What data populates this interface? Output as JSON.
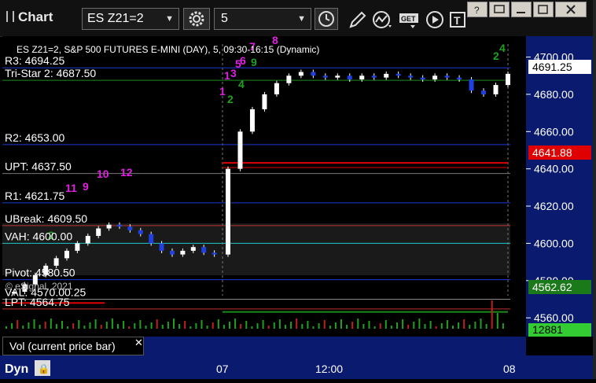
{
  "window": {
    "title": "Chart",
    "symbol": "ES Z21=2",
    "interval": "5",
    "dyn_label": "Dyn"
  },
  "chart": {
    "header_text": "ES Z21=2, S&P 500 FUTURES E-MINI (DAY), 5, 09:30-16:15 (Dynamic)",
    "copyright": "© eSignal, 2021",
    "volume_panel_label": "Vol (current price bar)",
    "levels": [
      {
        "label": "R3: 4694.25",
        "value": 4694.25,
        "color": "#1b3bd6"
      },
      {
        "label": "Tri-Star 2: 4687.50",
        "value": 4687.5,
        "color": "#1f8a1f"
      },
      {
        "label": "R2: 4653.00",
        "value": 4653.0,
        "color": "#1b3bd6"
      },
      {
        "label": "UPT: 4637.50",
        "value": 4637.5,
        "color": "#777777"
      },
      {
        "label": "R1: 4621.75",
        "value": 4621.75,
        "color": "#1b3bd6"
      },
      {
        "label": "UBreak: 4609.50",
        "value": 4609.5,
        "color": "#c23030"
      },
      {
        "label": "VAH: 4600.00",
        "value": 4600.0,
        "color": "#20c8c8"
      },
      {
        "label": "Pivot: 4580.50",
        "value": 4580.5,
        "color": "#1b3bd6"
      },
      {
        "label": "VAL: 4570.00.25",
        "value": 4570.0,
        "color": "#888888"
      },
      {
        "label": "LPT: 4564.75",
        "value": 4564.75,
        "color": "#c23030"
      }
    ],
    "price_ticks": [
      "4700.00",
      "4680.00",
      "4660.00",
      "4640.00",
      "4620.00",
      "4600.00",
      "4580.00",
      "4560.00"
    ],
    "price_range": [
      4555,
      4707
    ],
    "last_price": "4691.25",
    "red_marker_price": "4641.88",
    "green_marker_price": "4562.62",
    "volume_value": "12881",
    "time_labels": [
      "07",
      "12:00",
      "08"
    ]
  },
  "colors": {
    "axis_bg": "#0a1a6e",
    "last_price_bg": "#ffffff",
    "red_marker_bg": "#e00000",
    "green_marker_bg": "#1a7a1a",
    "volume_bg": "#33cc33",
    "magenta": "#e020e0",
    "seq_green": "#20a020"
  },
  "chart_data": {
    "type": "candlestick",
    "title": "ES Z21=2, S&P 500 FUTURES E-MINI (DAY), 5, 09:30-16:15 (Dynamic)",
    "ylim": [
      4555,
      4707
    ],
    "x_labels": [
      "07",
      "12:00",
      "08"
    ],
    "series": [
      {
        "name": "price",
        "values": [
          4574,
          4578,
          4583,
          4588,
          4592,
          4596,
          4600,
          4604,
          4608,
          4610,
          4609,
          4607,
          4605,
          4600,
          4596,
          4594,
          4596,
          4598,
          4595,
          4594,
          4640,
          4660,
          4672,
          4680,
          4686,
          4690,
          4692,
          4690,
          4689,
          4690,
          4688,
          4690,
          4689,
          4691,
          4690,
          4689,
          4688,
          4690,
          4689,
          4688,
          4682,
          4680,
          4685,
          4691
        ]
      }
    ]
  }
}
